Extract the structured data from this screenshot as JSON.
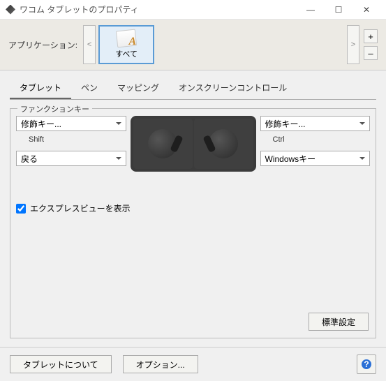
{
  "window": {
    "title": "ワコム タブレットのプロパティ",
    "min": "—",
    "max": "☐",
    "close": "✕"
  },
  "appRow": {
    "label": "アプリケーション:",
    "prev": "<",
    "next": ">",
    "items": [
      {
        "label": "すべて"
      }
    ],
    "plus": "+",
    "minus": "–"
  },
  "tabs": [
    {
      "label": "タブレット",
      "active": true
    },
    {
      "label": "ペン",
      "active": false
    },
    {
      "label": "マッピング",
      "active": false
    },
    {
      "label": "オンスクリーンコントロール",
      "active": false
    }
  ],
  "functionKeys": {
    "legend": "ファンクションキー",
    "left": {
      "row1": {
        "select": "修飾キー...",
        "sub": "Shift"
      },
      "row2": {
        "select": "戻る",
        "sub": ""
      }
    },
    "right": {
      "row1": {
        "select": "修飾キー...",
        "sub": "Ctrl"
      },
      "row2": {
        "select": "Windowsキー",
        "sub": ""
      }
    },
    "expressView": {
      "checked": true,
      "label": "エクスプレスビューを表示"
    },
    "defaultBtn": "標準設定"
  },
  "footer": {
    "about": "タブレットについて",
    "options": "オプション..."
  }
}
